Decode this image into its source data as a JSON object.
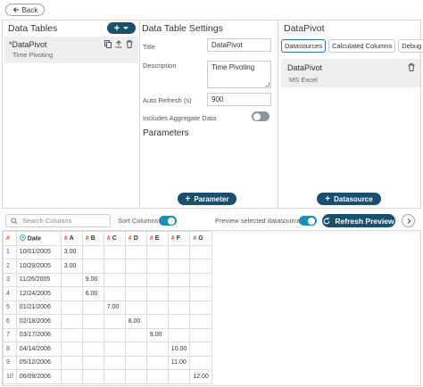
{
  "top": {
    "back_label": "Back"
  },
  "data_tables": {
    "title": "Data Tables",
    "add_label": "+",
    "item": {
      "name": "*DataPivot",
      "subtitle": "Time Pivoting"
    }
  },
  "settings": {
    "title": "Data Table Settings",
    "title_label": "Title",
    "title_value": "DataPivot",
    "description_label": "Description",
    "description_value": "Time Pivoting",
    "auto_refresh_label": "Auto Refresh (s)",
    "auto_refresh_value": "900",
    "aggregate_label": "Includes Aggregate Data",
    "aggregate_on": false,
    "parameters_title": "Parameters",
    "add_parameter_label": "Parameter"
  },
  "datapivot": {
    "title": "DataPivot",
    "tabs": [
      {
        "label": "Datasources",
        "active": true
      },
      {
        "label": "Calculated Columns",
        "active": false
      },
      {
        "label": "Debug",
        "active": false
      }
    ],
    "datasource": {
      "name": "DataPivot",
      "subtitle": "MS Excel"
    },
    "add_datasource_label": "Datasource"
  },
  "preview": {
    "search_placeholder": "Search Columns",
    "sort_columns_label": "Sort Columns",
    "sort_on": true,
    "preview_label": "Preview selected datasource",
    "preview_on": true,
    "refresh_label": "Refresh Preview",
    "columns": [
      "#",
      "Date",
      "A",
      "B",
      "C",
      "D",
      "E",
      "F",
      "G"
    ],
    "rows": [
      [
        "1",
        "10/01/2005",
        "3.00",
        "",
        "",
        "",
        "",
        "",
        ""
      ],
      [
        "2",
        "10/29/2005",
        "3.00",
        "",
        "",
        "",
        "",
        "",
        ""
      ],
      [
        "3",
        "11/26/2005",
        "",
        "9.00",
        "",
        "",
        "",
        "",
        ""
      ],
      [
        "4",
        "12/24/2005",
        "",
        "6.00",
        "",
        "",
        "",
        "",
        ""
      ],
      [
        "5",
        "01/21/2006",
        "",
        "",
        "7.00",
        "",
        "",
        "",
        ""
      ],
      [
        "6",
        "02/18/2006",
        "",
        "",
        "",
        "8.00",
        "",
        "",
        ""
      ],
      [
        "7",
        "03/17/2006",
        "",
        "",
        "",
        "",
        "9.00",
        "",
        ""
      ],
      [
        "8",
        "04/14/2006",
        "",
        "",
        "",
        "",
        "",
        "10.00",
        ""
      ],
      [
        "9",
        "05/12/2006",
        "",
        "",
        "",
        "",
        "",
        "11.00",
        ""
      ],
      [
        "10",
        "06/09/2006",
        "",
        "",
        "",
        "",
        "",
        "",
        "12.00"
      ]
    ]
  },
  "colors": {
    "accent": "#1a4f6e",
    "toggle_on": "#1f8fb3",
    "numeric_hash": "#e0552b"
  }
}
